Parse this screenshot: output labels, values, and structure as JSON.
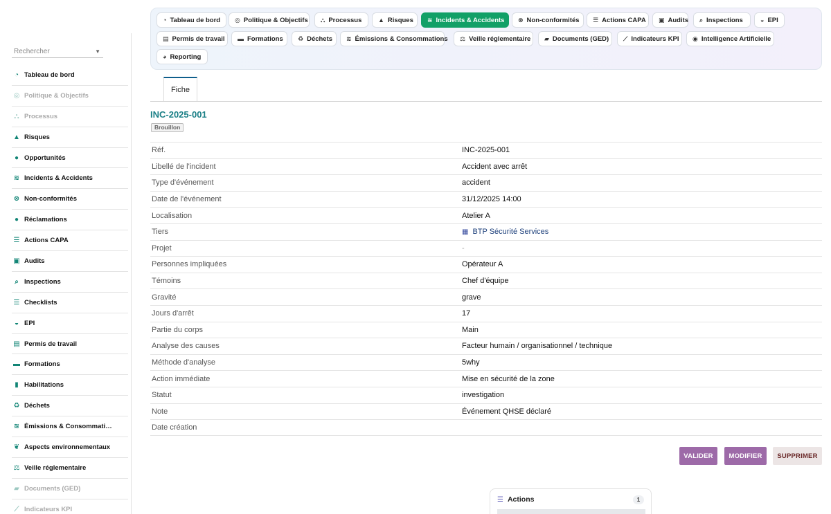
{
  "sidebar": {
    "search_placeholder": "Rechercher",
    "items": [
      {
        "label": "Tableau de bord",
        "icon": "gauge-icon",
        "glyph": "◔",
        "disabled": false
      },
      {
        "label": "Politique & Objectifs",
        "icon": "target-icon",
        "glyph": "◎",
        "disabled": true
      },
      {
        "label": "Processus",
        "icon": "flow-icon",
        "glyph": "⛬",
        "disabled": true
      },
      {
        "label": "Risques",
        "icon": "warning-icon",
        "glyph": "▲",
        "disabled": false
      },
      {
        "label": "Opportunités",
        "icon": "lightbulb-icon",
        "glyph": "●",
        "disabled": false
      },
      {
        "label": "Incidents & Accidents",
        "icon": "handshake-icon",
        "glyph": "≋",
        "disabled": false
      },
      {
        "label": "Non-conformités",
        "icon": "x-circle-icon",
        "glyph": "⊗",
        "disabled": false
      },
      {
        "label": "Réclamations",
        "icon": "comment-icon",
        "glyph": "●",
        "disabled": false
      },
      {
        "label": "Actions CAPA",
        "icon": "list-icon",
        "glyph": "☰",
        "disabled": false
      },
      {
        "label": "Audits",
        "icon": "clipboard-check-icon",
        "glyph": "▣",
        "disabled": false
      },
      {
        "label": "Inspections",
        "icon": "search-icon",
        "glyph": "⌕",
        "disabled": false
      },
      {
        "label": "Checklists",
        "icon": "checklist-icon",
        "glyph": "☰",
        "disabled": false
      },
      {
        "label": "EPI",
        "icon": "helmet-icon",
        "glyph": "◒",
        "disabled": false
      },
      {
        "label": "Permis de travail",
        "icon": "file-signature-icon",
        "glyph": "▤",
        "disabled": false
      },
      {
        "label": "Formations",
        "icon": "chalkboard-icon",
        "glyph": "▬",
        "disabled": false
      },
      {
        "label": "Habilitations",
        "icon": "id-badge-icon",
        "glyph": "▮",
        "disabled": false
      },
      {
        "label": "Déchets",
        "icon": "recycle-icon",
        "glyph": "♻",
        "disabled": false
      },
      {
        "label": "Émissions & Consommati…",
        "icon": "smog-icon",
        "glyph": "≋",
        "disabled": false
      },
      {
        "label": "Aspects environnementaux",
        "icon": "leaf-icon",
        "glyph": "❦",
        "disabled": false
      },
      {
        "label": "Veille réglementaire",
        "icon": "scale-icon",
        "glyph": "⚖",
        "disabled": false
      },
      {
        "label": "Documents (GED)",
        "icon": "folder-icon",
        "glyph": "▰",
        "disabled": true
      },
      {
        "label": "Indicateurs KPI",
        "icon": "chart-line-icon",
        "glyph": "⟋",
        "disabled": true
      }
    ]
  },
  "topnav": {
    "items": [
      {
        "label": "Tableau de bord",
        "icon": "gauge-icon",
        "glyph": "◔",
        "active": false
      },
      {
        "label": "Politique & Objectifs",
        "icon": "target-icon",
        "glyph": "◎",
        "active": false
      },
      {
        "label": "Processus",
        "icon": "flow-icon",
        "glyph": "⛬",
        "active": false
      },
      {
        "label": "Risques",
        "icon": "warning-icon",
        "glyph": "▲",
        "active": false
      },
      {
        "label": "Incidents & Accidents",
        "icon": "handshake-icon",
        "glyph": "≋",
        "active": true
      },
      {
        "label": "Non-conformités",
        "icon": "x-circle-icon",
        "glyph": "⊗",
        "active": false
      },
      {
        "label": "Actions CAPA",
        "icon": "list-icon",
        "glyph": "☰",
        "active": false
      },
      {
        "label": "Audits",
        "icon": "clipboard-check-icon",
        "glyph": "▣",
        "active": false
      },
      {
        "label": "Inspections",
        "icon": "search-icon",
        "glyph": "⌕",
        "active": false
      },
      {
        "label": "EPI",
        "icon": "helmet-icon",
        "glyph": "◒",
        "active": false
      },
      {
        "label": "Permis de travail",
        "icon": "file-signature-icon",
        "glyph": "▤",
        "active": false
      },
      {
        "label": "Formations",
        "icon": "chalkboard-icon",
        "glyph": "▬",
        "active": false
      },
      {
        "label": "Déchets",
        "icon": "recycle-icon",
        "glyph": "♻",
        "active": false
      },
      {
        "label": "Émissions & Consommations",
        "icon": "smog-icon",
        "glyph": "≋",
        "active": false
      },
      {
        "label": "Veille réglementaire",
        "icon": "scale-icon",
        "glyph": "⚖",
        "active": false
      },
      {
        "label": "Documents (GED)",
        "icon": "folder-icon",
        "glyph": "▰",
        "active": false
      },
      {
        "label": "Indicateurs KPI",
        "icon": "chart-line-icon",
        "glyph": "⟋",
        "active": false
      },
      {
        "label": "Intelligence Artificielle",
        "icon": "robot-icon",
        "glyph": "◉",
        "active": false
      },
      {
        "label": "Reporting",
        "icon": "chart-pie-icon",
        "glyph": "◕",
        "active": false
      }
    ]
  },
  "tabs": {
    "fiche": "Fiche"
  },
  "record": {
    "ref": "INC-2025-001",
    "status": "Brouillon",
    "fields": [
      {
        "label": "Réf.",
        "value": "INC-2025-001",
        "type": "text"
      },
      {
        "label": "Libellé de l'incident",
        "value": "Accident avec arrêt",
        "type": "text"
      },
      {
        "label": "Type d'événement",
        "value": "accident",
        "type": "text"
      },
      {
        "label": "Date de l'événement",
        "value": "31/12/2025 14:00",
        "type": "text"
      },
      {
        "label": "Localisation",
        "value": "Atelier A",
        "type": "text"
      },
      {
        "label": "Tiers",
        "value": "BTP Sécurité Services",
        "type": "link",
        "icon": "building-icon"
      },
      {
        "label": "Projet",
        "value": "-",
        "type": "muted"
      },
      {
        "label": "Personnes impliquées",
        "value": "Opérateur A",
        "type": "text"
      },
      {
        "label": "Témoins",
        "value": "Chef d'équipe",
        "type": "text"
      },
      {
        "label": "Gravité",
        "value": "grave",
        "type": "text"
      },
      {
        "label": "Jours d'arrêt",
        "value": "17",
        "type": "text"
      },
      {
        "label": "Partie du corps",
        "value": "Main",
        "type": "text"
      },
      {
        "label": "Analyse des causes",
        "value": "Facteur humain / organisationnel / technique",
        "type": "text"
      },
      {
        "label": "Méthode d'analyse",
        "value": "5why",
        "type": "text"
      },
      {
        "label": "Action immédiate",
        "value": "Mise en sécurité de la zone",
        "type": "text"
      },
      {
        "label": "Statut",
        "value": "investigation",
        "type": "text"
      },
      {
        "label": "Note",
        "value": "Événement QHSE déclaré",
        "type": "text"
      },
      {
        "label": "Date création",
        "value": "",
        "type": "text"
      }
    ]
  },
  "buttons": {
    "valider": "VALIDER",
    "modifier": "MODIFIER",
    "supprimer": "SUPPRIMER"
  },
  "actions_panel": {
    "title": "Actions",
    "count": "1"
  },
  "colors": {
    "accent": "#12a067",
    "teal": "#1a7f86",
    "button_purple": "#9d6aa8"
  }
}
